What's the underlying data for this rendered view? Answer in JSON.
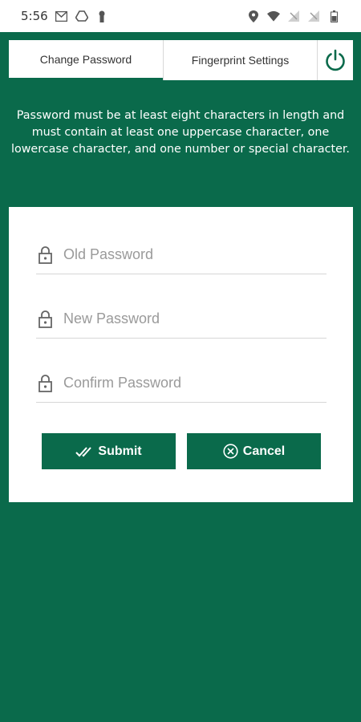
{
  "status_bar": {
    "time": "5:56",
    "left_icons": [
      "gmail-icon",
      "drive-icon",
      "keyhole-icon"
    ],
    "right_icons": [
      "location-icon",
      "wifi-icon",
      "no-signal-icon",
      "no-signal-icon",
      "battery-icon"
    ]
  },
  "tabs": {
    "change_password": "Change Password",
    "fingerprint_settings": "Fingerprint Settings",
    "power_icon": "power-icon"
  },
  "info": {
    "text": "Password must be at least eight characters in length and must contain at least one uppercase character, one lowercase character, and one number or special character."
  },
  "form": {
    "old_password": {
      "value": "",
      "placeholder": "Old Password"
    },
    "new_password": {
      "value": "",
      "placeholder": "New Password"
    },
    "confirm_password": {
      "value": "",
      "placeholder": "Confirm Password"
    },
    "submit_label": "Submit",
    "cancel_label": "Cancel"
  },
  "colors": {
    "brand_green": "#0a6a4b",
    "card_bg": "#ffffff"
  }
}
